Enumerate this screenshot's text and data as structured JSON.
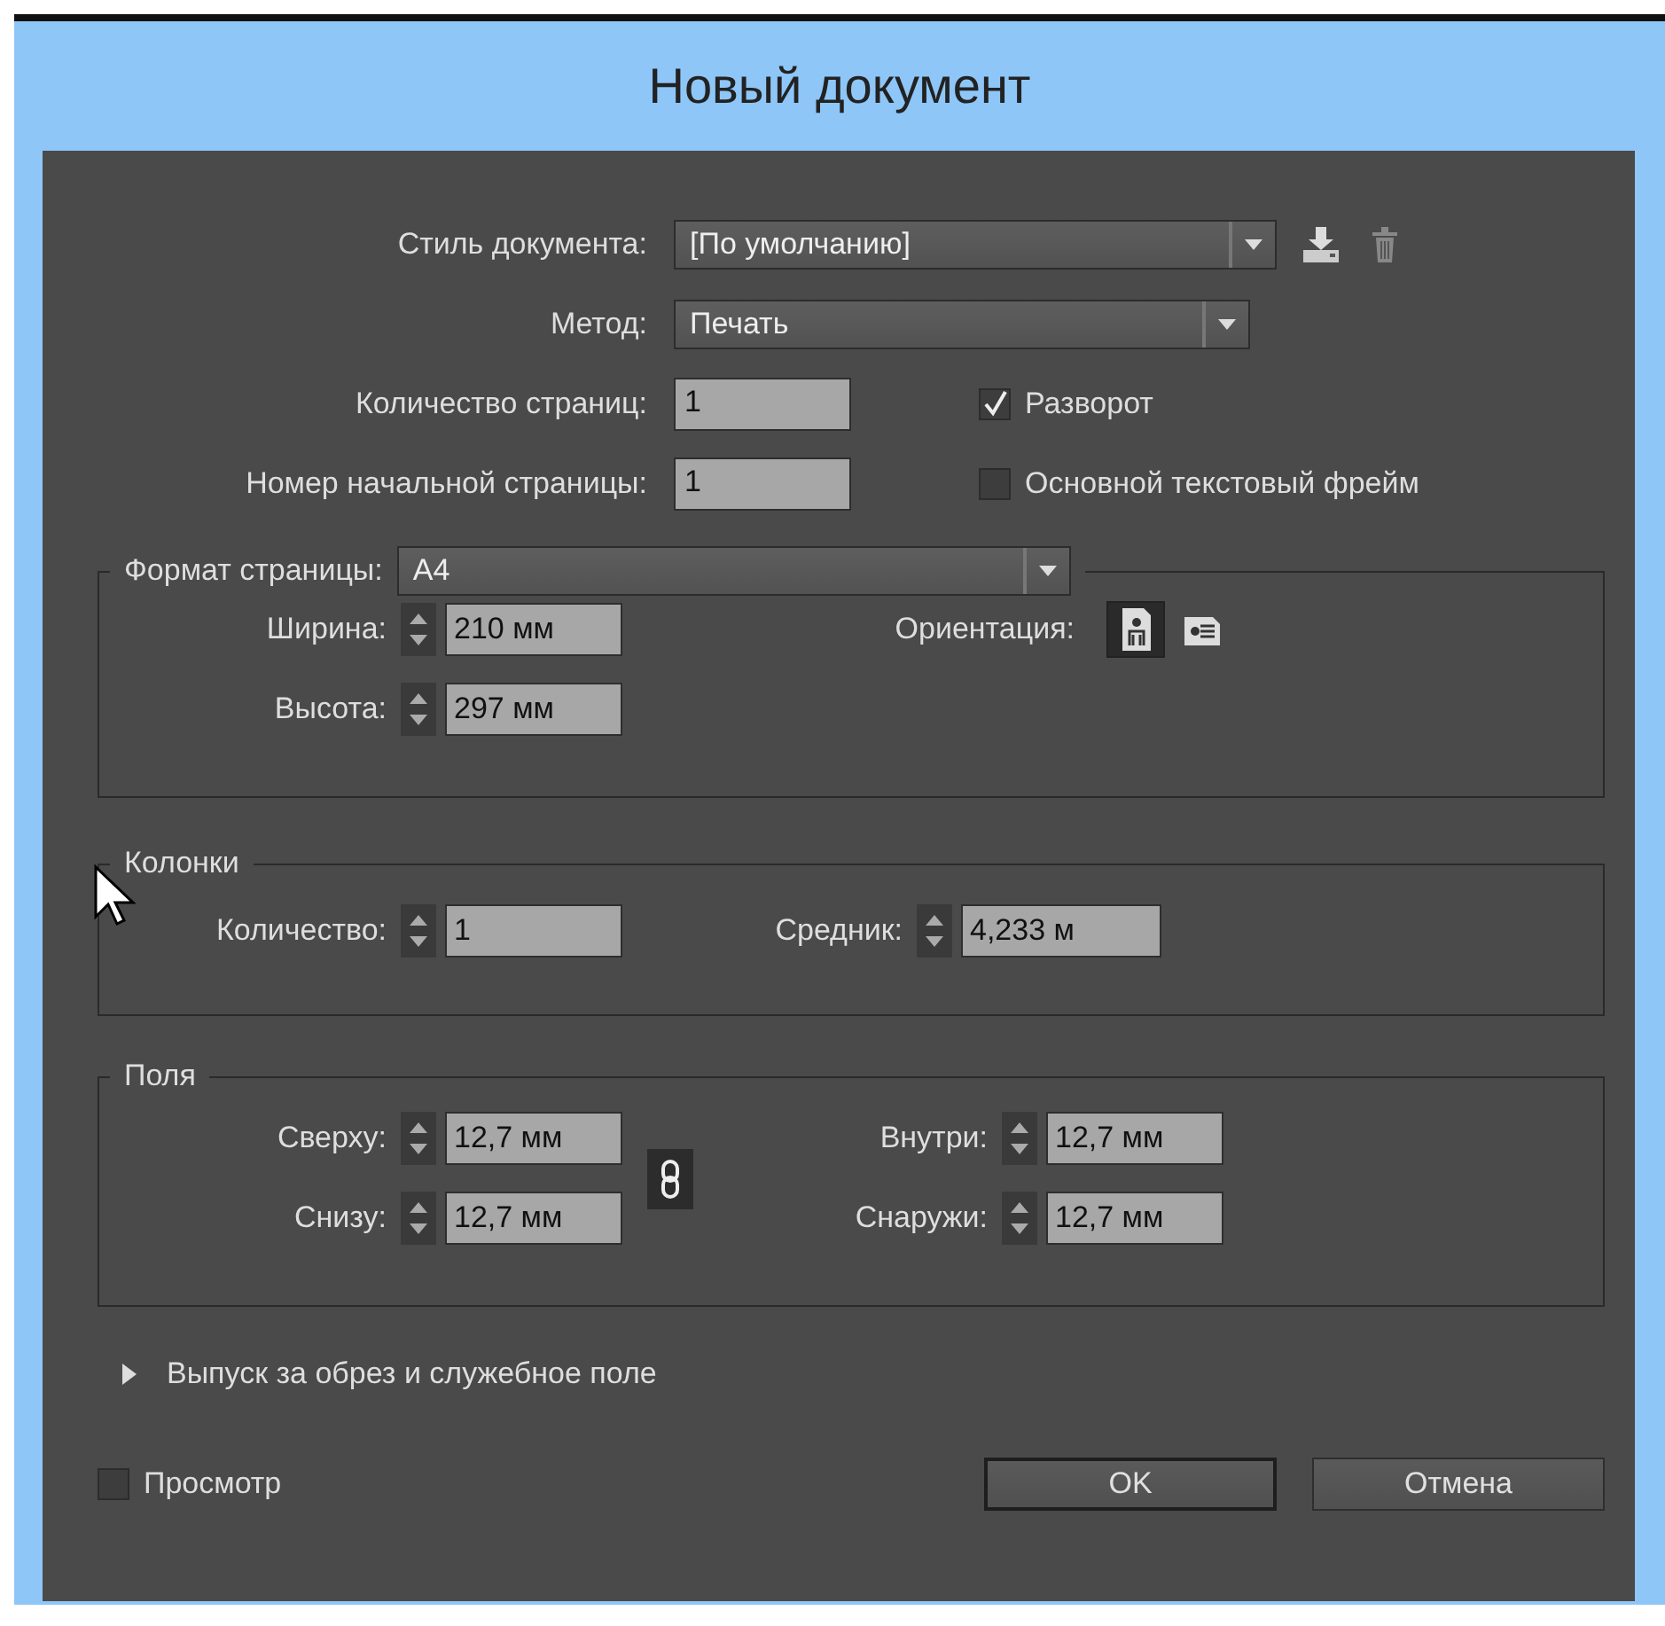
{
  "window": {
    "title": "Новый документ"
  },
  "document_style": {
    "label": "Стиль документа:",
    "value": "[По умолчанию]"
  },
  "intent": {
    "label": "Метод:",
    "value": "Печать"
  },
  "pages": {
    "label": "Количество страниц:",
    "value": "1"
  },
  "start_page": {
    "label": "Номер начальной страницы:",
    "value": "1"
  },
  "facing_pages": {
    "label": "Разворот",
    "checked": true
  },
  "primary_text_frame": {
    "label": "Основной текстовый фрейм",
    "checked": false
  },
  "page_size": {
    "label": "Формат страницы:",
    "value": "A4",
    "width": {
      "label": "Ширина:",
      "value": "210 мм"
    },
    "height": {
      "label": "Высота:",
      "value": "297 мм"
    },
    "orientation": {
      "label": "Ориентация:",
      "options": [
        {
          "kind": "portrait",
          "selected": true
        },
        {
          "kind": "landscape",
          "selected": false
        }
      ]
    }
  },
  "columns": {
    "title": "Колонки",
    "number": {
      "label": "Количество:",
      "value": "1"
    },
    "gutter": {
      "label": "Средник:",
      "value": "4,233 м"
    }
  },
  "margins": {
    "title": "Поля",
    "linked": true,
    "fields": [
      {
        "label": "Сверху:",
        "value": "12,7 мм"
      },
      {
        "label": "Внутри:",
        "value": "12,7 мм"
      },
      {
        "label": "Снизу:",
        "value": "12,7 мм"
      },
      {
        "label": "Снаружи:",
        "value": "12,7 мм"
      }
    ]
  },
  "bleed": {
    "label": "Выпуск за обрез и служебное поле",
    "expanded": false
  },
  "preview": {
    "label": "Просмотр",
    "checked": false
  },
  "buttons": [
    {
      "label": "OK",
      "kind": "default"
    },
    {
      "label": "Отмена",
      "kind": "normal"
    }
  ]
}
